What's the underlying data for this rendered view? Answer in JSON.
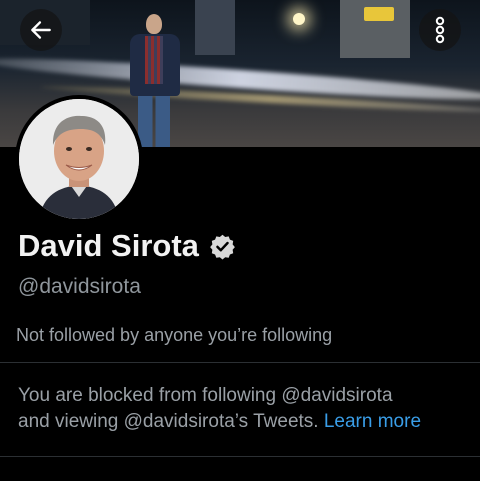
{
  "profile": {
    "name": "David Sirota",
    "handle": "@davidsirota",
    "verified": true,
    "followers_note": "Not followed by anyone you’re following"
  },
  "blocked_notice": {
    "line1": "You are blocked from following @davidsirota",
    "line2_prefix": "and viewing @davidsirota’s Tweets. ",
    "learn_more": "Learn more"
  },
  "colors": {
    "background": "#000000",
    "link": "#3a9ee8",
    "secondary_text": "#8f969c"
  },
  "icons": {
    "back": "arrow-left-icon",
    "more": "more-vertical-icon",
    "verified": "verified-badge-icon"
  }
}
